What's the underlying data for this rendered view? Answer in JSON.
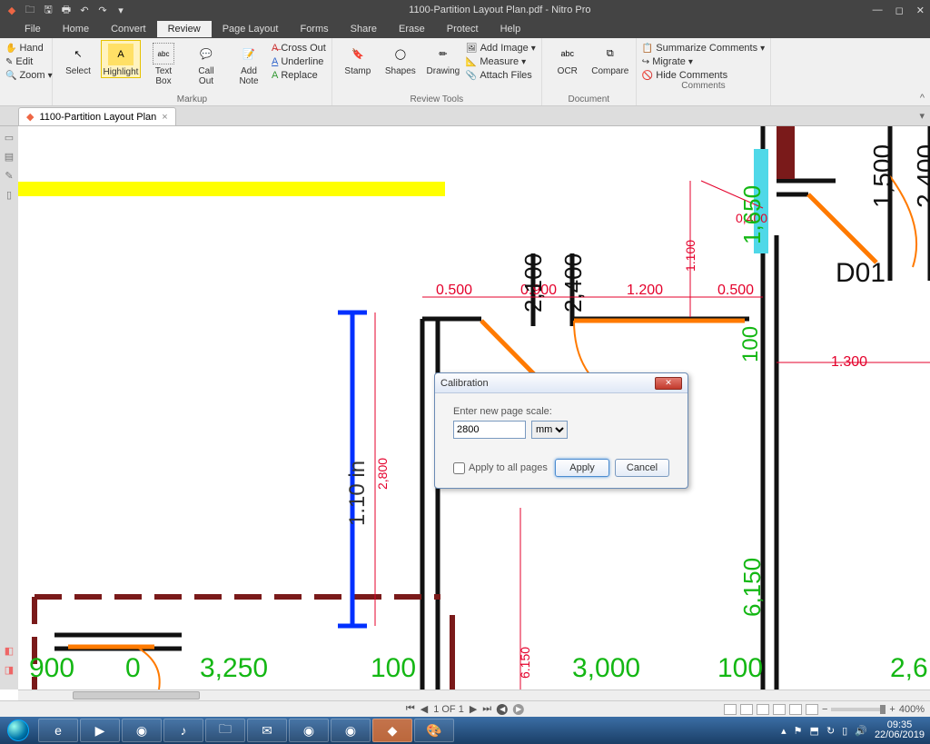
{
  "app": {
    "title": "1100-Partition Layout Plan.pdf - Nitro Pro"
  },
  "menu": {
    "file": "File",
    "home": "Home",
    "convert": "Convert",
    "review": "Review",
    "page_layout": "Page Layout",
    "forms": "Forms",
    "share": "Share",
    "erase": "Erase",
    "protect": "Protect",
    "help": "Help"
  },
  "ribbon": {
    "hand": "Hand",
    "edit": "Edit",
    "zoom": "Zoom",
    "select": "Select",
    "highlight": "Highlight",
    "text_box": "Text\nBox",
    "call_out": "Call\nOut",
    "add_note": "Add\nNote",
    "cross_out": "Cross Out",
    "underline": "Underline",
    "replace": "Replace",
    "markup": "Markup",
    "stamp": "Stamp",
    "shapes": "Shapes",
    "drawing": "Drawing",
    "add_image": "Add Image",
    "measure": "Measure",
    "attach_files": "Attach Files",
    "review_tools": "Review Tools",
    "ocr": "OCR",
    "compare": "Compare",
    "document": "Document",
    "summarize": "Summarize Comments",
    "migrate": "Migrate",
    "hide_comments": "Hide Comments",
    "comments": "Comments"
  },
  "doc_tab": {
    "name": "1100-Partition Layout Plan"
  },
  "dialog": {
    "title": "Calibration",
    "label": "Enter new page scale:",
    "value": "2800",
    "unit": "mm",
    "apply_all": "Apply to all pages",
    "apply": "Apply",
    "cancel": "Cancel"
  },
  "status": {
    "page": "1 OF 1",
    "zoom": "400%"
  },
  "tray": {
    "time": "09:35",
    "date": "22/06/2019"
  },
  "drawing": {
    "measure": "1.10 in",
    "d1": "0.500",
    "d2": "0.900",
    "d3": "1.200",
    "d4": "0.500",
    "d5": "1.300",
    "d6": "1.100",
    "d7": "0,400",
    "v1": "2,100",
    "v2": "2,400",
    "v3": "1,650",
    "v4": "1,500",
    "v5": "2,400",
    "v6": "100",
    "v7": "6,150",
    "v8": "2,800",
    "v9": "6.150",
    "g1": "900",
    "g2": "0",
    "g3": "3,250",
    "g4": "100",
    "g5": "3,000",
    "g6": "100",
    "g7": "2,6",
    "door": "D01"
  }
}
